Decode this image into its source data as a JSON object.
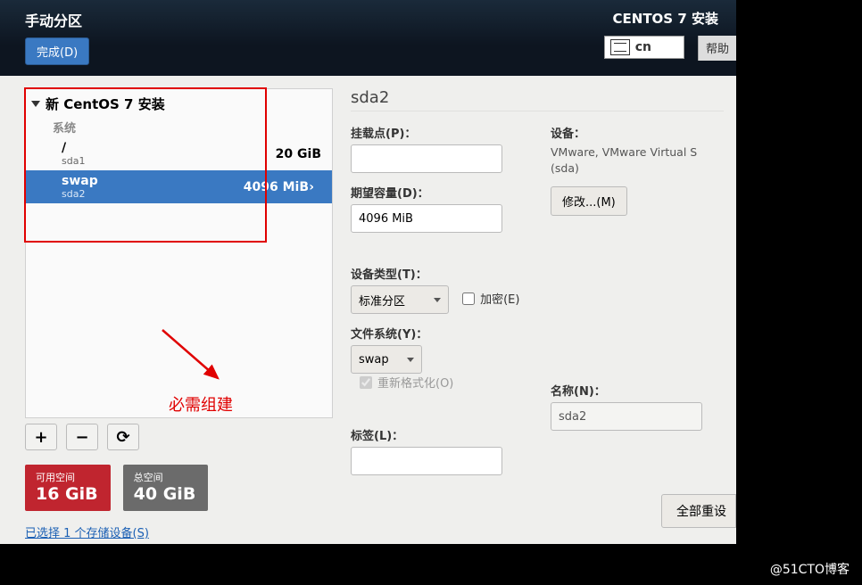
{
  "header": {
    "title_left": "手动分区",
    "title_right": "CENTOS 7 安装",
    "done_label": "完成(D)",
    "keyboard_layout": "cn",
    "help_label": "帮助"
  },
  "annotation": {
    "text": "必需组建"
  },
  "partitions": {
    "tree_header": "新 CentOS 7 安装",
    "section_label": "系统",
    "items": [
      {
        "name": "/",
        "dev": "sda1",
        "size": "20 GiB",
        "selected": false
      },
      {
        "name": "swap",
        "dev": "sda2",
        "size": "4096 MiB",
        "selected": true
      }
    ]
  },
  "toolbar": {
    "add": "+",
    "remove": "−",
    "reload": "⟳"
  },
  "space": {
    "avail_label": "可用空间",
    "avail_value": "16 GiB",
    "total_label": "总空间",
    "total_value": "40 GiB"
  },
  "devices_link": "已选择 1 个存储设备(S)",
  "right": {
    "title": "sda2",
    "mount_label": "挂载点(P)：",
    "mount_value": "",
    "capacity_label": "期望容量(D)：",
    "capacity_value": "4096 MiB",
    "device_label": "设备：",
    "device_text": "VMware, VMware Virtual S (sda)",
    "modify_label": "修改...(M)",
    "devtype_label": "设备类型(T)：",
    "devtype_value": "标准分区",
    "encrypt_label": "加密(E)",
    "fs_label": "文件系统(Y)：",
    "fs_value": "swap",
    "reformat_label": "重新格式化(O)",
    "tag_label": "标签(L)：",
    "tag_value": "",
    "name_label": "名称(N)：",
    "name_value": "sda2",
    "reset_label": "全部重设"
  },
  "watermark": "@51CTO博客"
}
